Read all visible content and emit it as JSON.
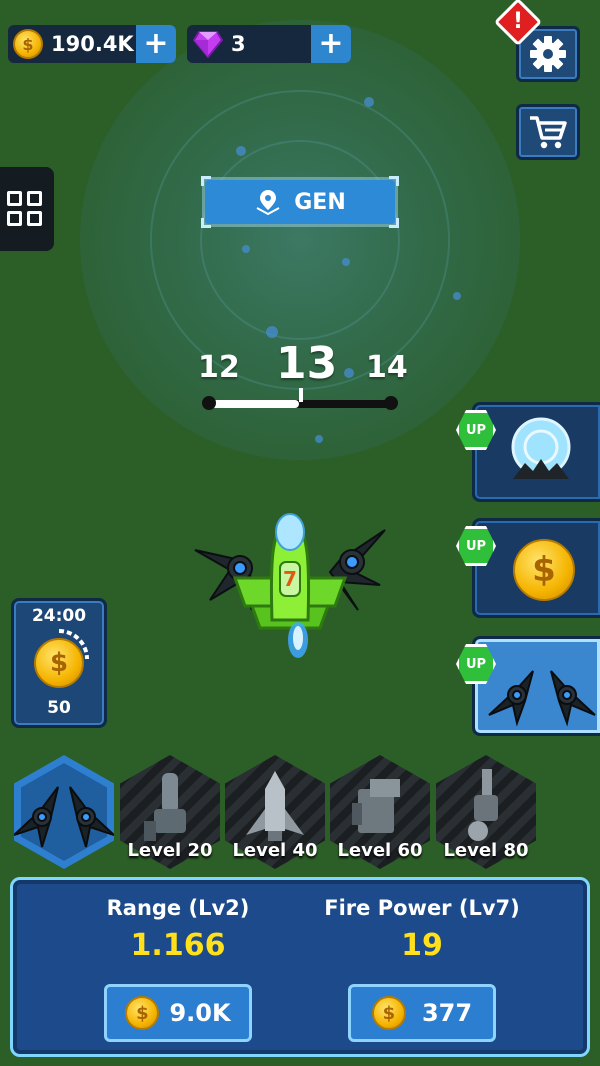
{
  "resources": {
    "coins": "190.4K",
    "gems": "3"
  },
  "top_right": {
    "alert_symbol": "!"
  },
  "map": {
    "location_label": "GEN",
    "levels": {
      "prev": "12",
      "current": "13",
      "next": "14"
    },
    "level_progress": 0.5
  },
  "upgrades": [
    {
      "badge": "UP",
      "icon": "shield-ship-icon"
    },
    {
      "badge": "UP",
      "icon": "coin-icon"
    },
    {
      "badge": "UP",
      "icon": "wing-drones-icon",
      "active": true
    }
  ],
  "timer": {
    "time": "24:00",
    "reward": "50"
  },
  "wing_slots": [
    {
      "icon": "wing-drone-icon",
      "label": "",
      "selected": true
    },
    {
      "icon": "cannon-icon",
      "label": "Level 20"
    },
    {
      "icon": "missile-icon",
      "label": "Level 40"
    },
    {
      "icon": "turret-icon",
      "label": "Level 60"
    },
    {
      "icon": "blaster-icon",
      "label": "Level 80"
    }
  ],
  "stats": {
    "range": {
      "label": "Range (Lv2)",
      "value": "1.166",
      "cost": "9.0K"
    },
    "fire_power": {
      "label": "Fire Power (Lv7)",
      "value": "19",
      "cost": "377"
    }
  },
  "colors": {
    "background": "#2c5e28",
    "accent_blue": "#2d8ad6",
    "stat_value_yellow": "#ffe01a",
    "up_green": "#2fbf3a"
  }
}
